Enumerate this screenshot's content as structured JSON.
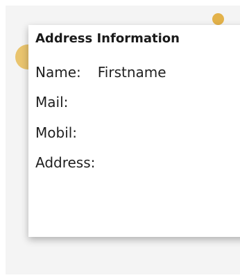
{
  "card": {
    "title": "Address Information",
    "fields": [
      {
        "label": "Name:",
        "value": "Firstname"
      },
      {
        "label": "Mail:",
        "value": ""
      },
      {
        "label": "Mobil:",
        "value": ""
      },
      {
        "label": "Address:",
        "value": ""
      }
    ]
  },
  "colors": {
    "accent_dot": "#e3b24a",
    "background": "#f4f4f4",
    "card": "#ffffff"
  }
}
